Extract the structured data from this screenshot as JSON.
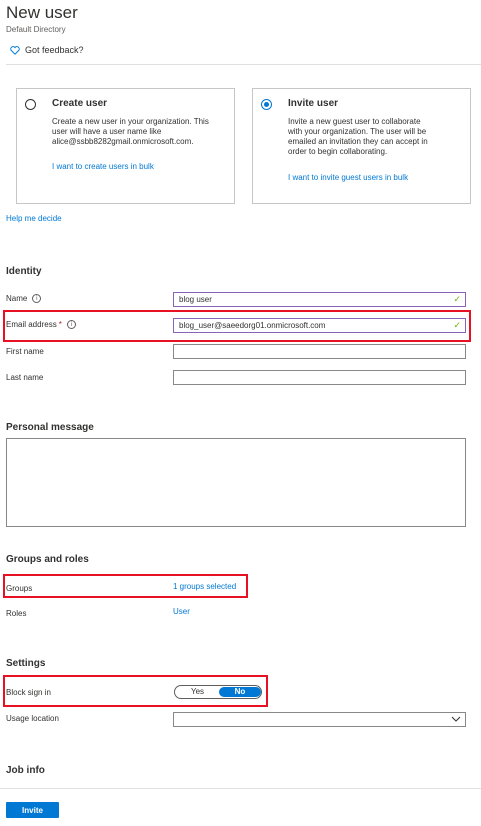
{
  "header": {
    "title": "New user",
    "subtitle": "Default Directory",
    "feedback": "Got feedback?"
  },
  "options": {
    "create": {
      "title": "Create user",
      "description": "Create a new user in your organization. This user will have a user name like alice@ssbb8282gmail.onmicrosoft.com.",
      "link": "I want to create users in bulk",
      "selected": false
    },
    "invite": {
      "title": "Invite user",
      "description": "Invite a new guest user to collaborate with your organization. The user will be emailed an invitation they can accept in order to begin collaborating.",
      "link": "I want to invite guest users in bulk",
      "selected": true
    }
  },
  "help_link": "Help me decide",
  "identity": {
    "heading": "Identity",
    "name_label": "Name",
    "name_value": "blog user",
    "email_label": "Email address",
    "email_required": "*",
    "email_value": "blog_user@saeedorg01.onmicrosoft.com",
    "first_name_label": "First name",
    "first_name_value": "",
    "last_name_label": "Last name",
    "last_name_value": ""
  },
  "personal_message": {
    "heading": "Personal message",
    "value": ""
  },
  "groups_roles": {
    "heading": "Groups and roles",
    "groups_label": "Groups",
    "groups_value": "1 groups selected",
    "roles_label": "Roles",
    "roles_value": "User"
  },
  "settings": {
    "heading": "Settings",
    "block_label": "Block sign in",
    "toggle_yes": "Yes",
    "toggle_no": "No",
    "toggle_selected": "No",
    "usage_location_label": "Usage location",
    "usage_location_value": ""
  },
  "job_info": {
    "heading": "Job info"
  },
  "footer": {
    "invite_button": "Invite"
  },
  "colors": {
    "accent": "#0078d4",
    "highlight": "#e81123",
    "valid_check": "#6bb700"
  }
}
